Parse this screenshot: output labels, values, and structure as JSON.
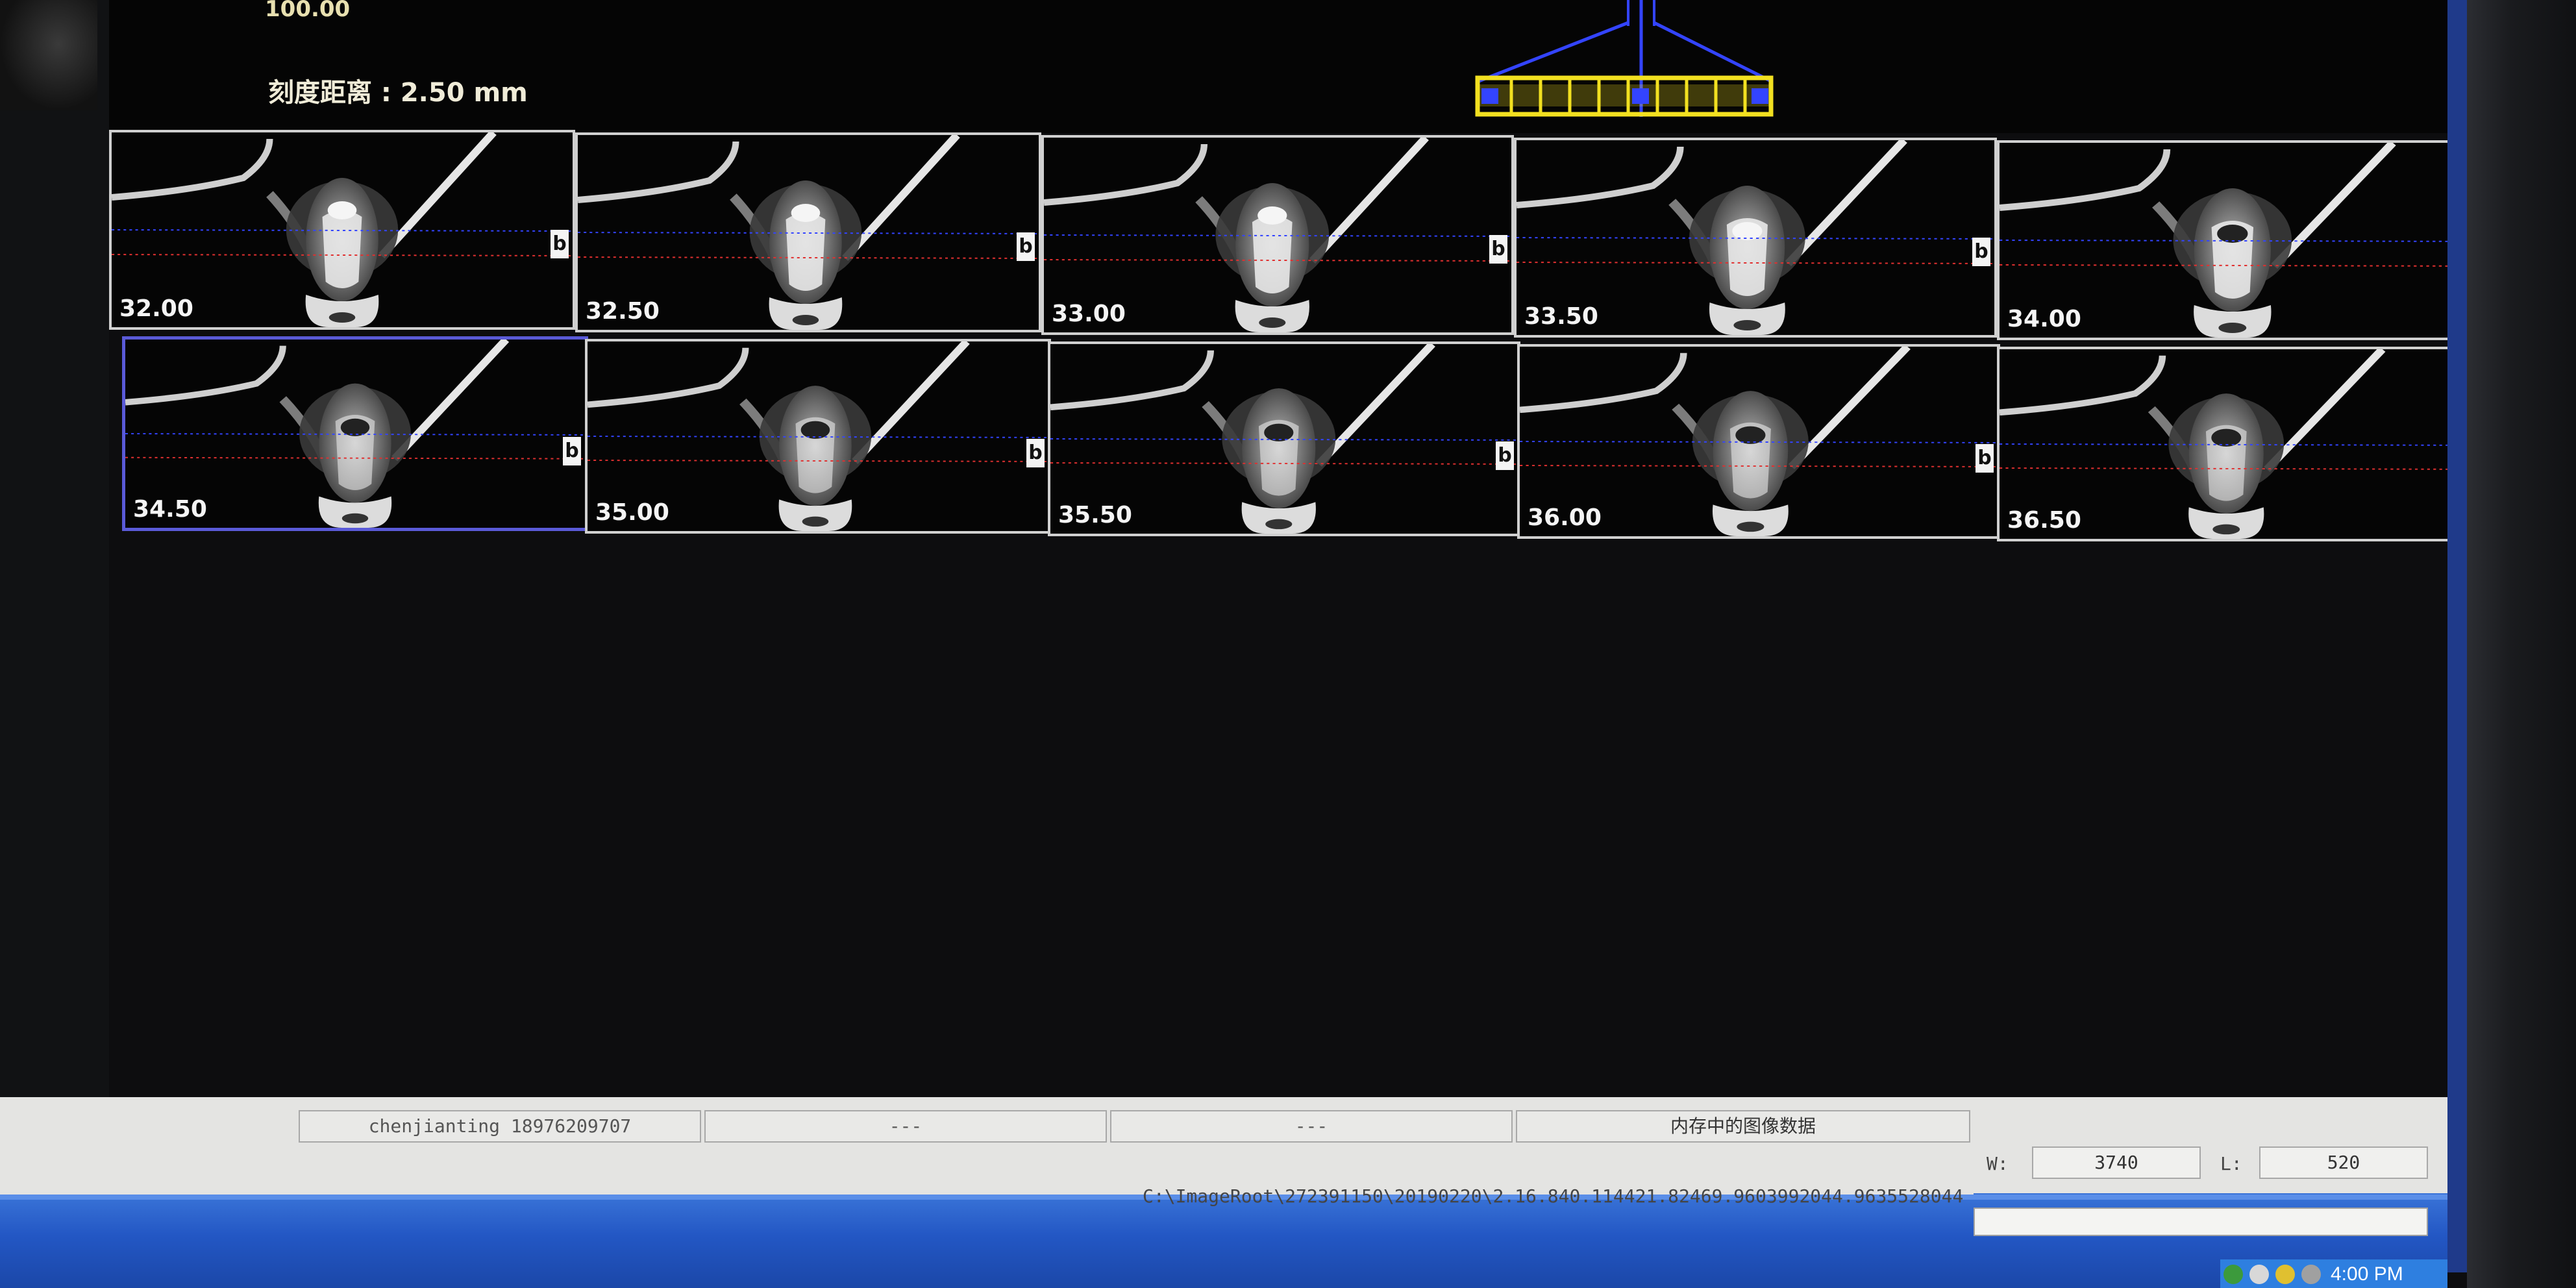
{
  "header": {
    "top_value": "100.00",
    "scale_label": "刻度距离 : 2.50 mm"
  },
  "slices": [
    {
      "label": "32.00"
    },
    {
      "label": "32.50"
    },
    {
      "label": "33.00"
    },
    {
      "label": "33.50"
    },
    {
      "label": "34.00"
    },
    {
      "label": "34.50"
    },
    {
      "label": "35.00"
    },
    {
      "label": "35.50"
    },
    {
      "label": "36.00"
    },
    {
      "label": "36.50"
    }
  ],
  "slice_marker": "b",
  "selected_slice": "34.50",
  "statusbar": {
    "user": "chenjianting 18976209707",
    "field2": "---",
    "field3": "---",
    "memory_status": "内存中的图像数据",
    "path": "C:\\ImageRoot\\272391150\\20190220\\2.16.840.114421.82469.9603992044.9635528044",
    "w_label": "W:",
    "w_value": "3740",
    "l_label": "L:",
    "l_value": "520"
  },
  "taskbar": {
    "time": "4:00 PM"
  },
  "colors": {
    "blue_guide": "#3344ff",
    "red_guide": "#e03030",
    "ruler_yellow": "#f2e020",
    "selected_border": "#5a5ad8"
  }
}
